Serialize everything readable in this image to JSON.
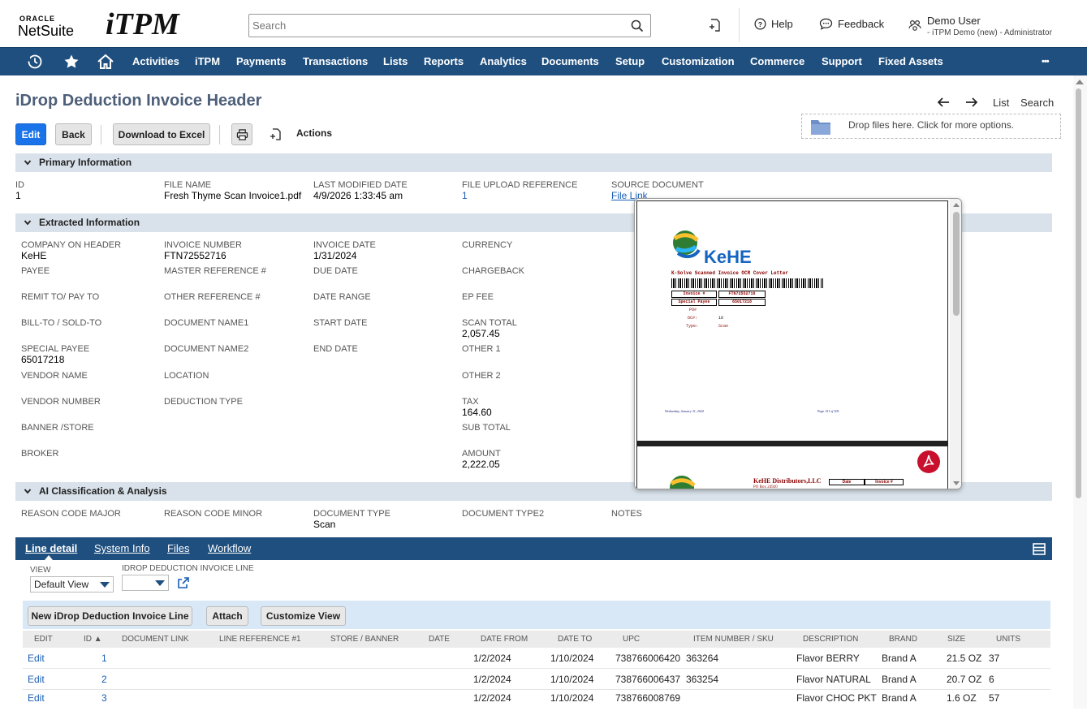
{
  "header": {
    "oracle": "ORACLE",
    "netsuite": "NetSuite",
    "itpm_logo": "iTPM",
    "search_placeholder": "Search",
    "help": "Help",
    "feedback": "Feedback",
    "user_name": "Demo User",
    "user_role": "- iTPM Demo (new) - Administrator"
  },
  "nav": {
    "items": [
      "Activities",
      "iTPM",
      "Payments",
      "Transactions",
      "Lists",
      "Reports",
      "Analytics",
      "Documents",
      "Setup",
      "Customization",
      "Commerce",
      "Support",
      "Fixed Assets"
    ],
    "more": "•••"
  },
  "page": {
    "title": "iDrop Deduction Invoice Header",
    "edit": "Edit",
    "back": "Back",
    "download": "Download to Excel",
    "actions": "Actions",
    "list": "List",
    "search": "Search",
    "dropzone": "Drop files here. Click for more options."
  },
  "primary": {
    "title": "Primary Information",
    "id_label": "ID",
    "id_value": "1",
    "file_name_label": "FILE NAME",
    "file_name_value": "Fresh Thyme Scan Invoice1.pdf",
    "last_modified_label": "LAST MODIFIED DATE",
    "last_modified_value": "4/9/2026 1:33:45 am",
    "upload_ref_label": "FILE UPLOAD REFERENCE",
    "upload_ref_value": "1",
    "source_doc_label": "SOURCE DOCUMENT",
    "source_doc_value": "File Link"
  },
  "extracted": {
    "title": "Extracted Information",
    "col1": [
      {
        "label": "COMPANY ON HEADER",
        "value": "KeHE"
      },
      {
        "label": "PAYEE",
        "value": ""
      },
      {
        "label": "REMIT TO/ PAY TO",
        "value": ""
      },
      {
        "label": "BILL-TO / SOLD-TO",
        "value": ""
      },
      {
        "label": "SPECIAL PAYEE",
        "value": "65017218"
      },
      {
        "label": "VENDOR NAME",
        "value": ""
      },
      {
        "label": "VENDOR NUMBER",
        "value": ""
      },
      {
        "label": "BANNER /STORE",
        "value": ""
      },
      {
        "label": "BROKER",
        "value": ""
      }
    ],
    "col2": [
      {
        "label": "INVOICE NUMBER",
        "value": "FTN72552716"
      },
      {
        "label": "MASTER REFERENCE #",
        "value": ""
      },
      {
        "label": "OTHER REFERENCE #",
        "value": ""
      },
      {
        "label": "DOCUMENT NAME1",
        "value": ""
      },
      {
        "label": "DOCUMENT NAME2",
        "value": ""
      },
      {
        "label": "LOCATION",
        "value": ""
      },
      {
        "label": "DEDUCTION TYPE",
        "value": ""
      }
    ],
    "col3": [
      {
        "label": "INVOICE DATE",
        "value": "1/31/2024"
      },
      {
        "label": "DUE DATE",
        "value": ""
      },
      {
        "label": "DATE RANGE",
        "value": ""
      },
      {
        "label": "START DATE",
        "value": ""
      },
      {
        "label": "END DATE",
        "value": ""
      }
    ],
    "col4": [
      {
        "label": "CURRENCY",
        "value": ""
      },
      {
        "label": "CHARGEBACK",
        "value": ""
      },
      {
        "label": "EP FEE",
        "value": ""
      },
      {
        "label": "SCAN TOTAL",
        "value": "2,057.45"
      },
      {
        "label": "OTHER 1",
        "value": ""
      },
      {
        "label": "OTHER 2",
        "value": ""
      },
      {
        "label": "TAX",
        "value": "164.60"
      },
      {
        "label": "SUB TOTAL",
        "value": ""
      },
      {
        "label": "AMOUNT",
        "value": "2,222.05"
      }
    ]
  },
  "ai": {
    "title": "AI Classification & Analysis",
    "reason_major": "REASON CODE MAJOR",
    "reason_minor": "REASON CODE MINOR",
    "doc_type_label": "DOCUMENT TYPE",
    "doc_type_value": "Scan",
    "doc_type2": "DOCUMENT TYPE2",
    "notes": "NOTES"
  },
  "tabs": [
    "Line detail",
    "System Info",
    "Files",
    "Workflow"
  ],
  "sublist": {
    "view_label": "VIEW",
    "view_value": "Default View",
    "line_label": "IDROP DEDUCTION INVOICE LINE",
    "new_btn": "New iDrop Deduction Invoice Line",
    "attach_btn": "Attach",
    "customize_btn": "Customize View",
    "columns": [
      "EDIT",
      "ID ▲",
      "DOCUMENT LINK",
      "LINE REFERENCE #1",
      "STORE / BANNER",
      "DATE",
      "DATE FROM",
      "DATE TO",
      "UPC",
      "ITEM NUMBER / SKU",
      "DESCRIPTION",
      "BRAND",
      "SIZE",
      "UNITS"
    ],
    "rows": [
      {
        "edit": "Edit",
        "id": "1",
        "date_from": "1/2/2024",
        "date_to": "1/10/2024",
        "upc": "738766006420",
        "sku": "363264",
        "desc": "Flavor BERRY",
        "brand": "Brand A",
        "size": "21.5 OZ",
        "units": "37"
      },
      {
        "edit": "Edit",
        "id": "2",
        "date_from": "1/2/2024",
        "date_to": "1/10/2024",
        "upc": "738766006437",
        "sku": "363254",
        "desc": "Flavor NATURAL",
        "brand": "Brand A",
        "size": "20.7 OZ",
        "units": "6"
      },
      {
        "edit": "Edit",
        "id": "3",
        "date_from": "1/2/2024",
        "date_to": "1/10/2024",
        "upc": "738766008769",
        "sku": "",
        "desc": "Flavor CHOC PKT",
        "brand": "Brand A",
        "size": "1.6 OZ",
        "units": "57"
      }
    ]
  },
  "preview": {
    "kehe": "KeHE",
    "cover_title": "K-Solve Scanned Invoice OCR Cover Letter",
    "invoice_label": "Invoice #",
    "invoice_value": "FTN72552716",
    "payee_label": "Special Payee",
    "payee_value": "65017218",
    "po_label": "PO#",
    "dc_label": "DC#:",
    "dc_value": "16",
    "type_label": "Type:",
    "type_value": "Scan",
    "footer_left": "Wednesday, January 31, 2024",
    "footer_right": "Page 151 of 305",
    "page2_company": "KeHE Distributors,LLC",
    "page2_po": "PO Box 24920",
    "page2_date": "Date",
    "page2_invoice": "Invoice #"
  }
}
